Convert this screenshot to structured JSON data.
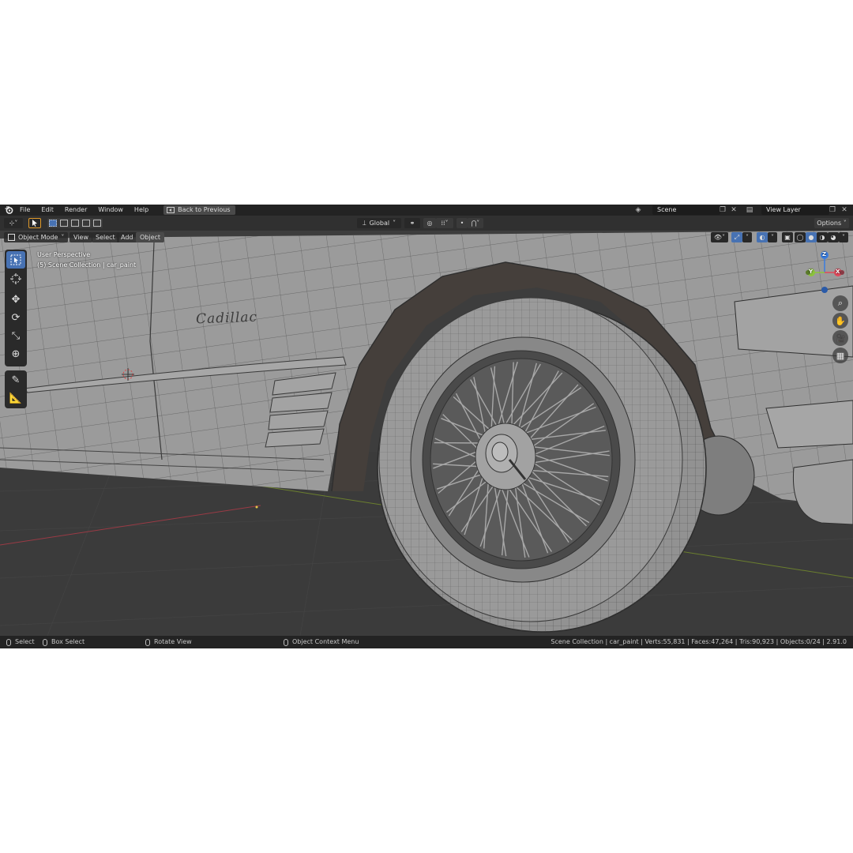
{
  "topbar": {
    "menu": [
      "File",
      "Edit",
      "Render",
      "Window",
      "Help"
    ],
    "back_button": "Back to Previous",
    "scene": "Scene",
    "view_layer": "View Layer"
  },
  "header": {
    "orientation": "Global",
    "options": "Options"
  },
  "tool_header": {
    "mode": "Object Mode",
    "view": "View",
    "select": "Select",
    "add": "Add",
    "object": "Object"
  },
  "viewport": {
    "perspective": "User Perspective",
    "collection": "(5) Scene Collection | car_paint",
    "emblem_text": "Cadillac",
    "gizmo": {
      "z": "Z",
      "y": "Y",
      "x": "X"
    }
  },
  "status": {
    "select": "Select",
    "box_select": "Box Select",
    "rotate_view": "Rotate View",
    "context_menu": "Object Context Menu",
    "stats": "Scene Collection | car_paint | Verts:55,831 | Faces:47,264 | Tris:90,923 | Objects:0/24 | 2.91.0"
  },
  "colors": {
    "accent": "#4772b3",
    "x_axis": "#e0485a",
    "y_axis": "#8cc43c",
    "z_axis": "#3a7de0",
    "mesh": "#9c9c9c"
  },
  "icons": [
    "blender-logo-icon",
    "select-box-icon",
    "cursor-icon",
    "move-icon",
    "rotate-icon",
    "scale-icon",
    "transform-icon",
    "annotate-icon",
    "measure-icon",
    "zoom-icon",
    "hand-icon",
    "camera-icon",
    "grid-icon"
  ]
}
